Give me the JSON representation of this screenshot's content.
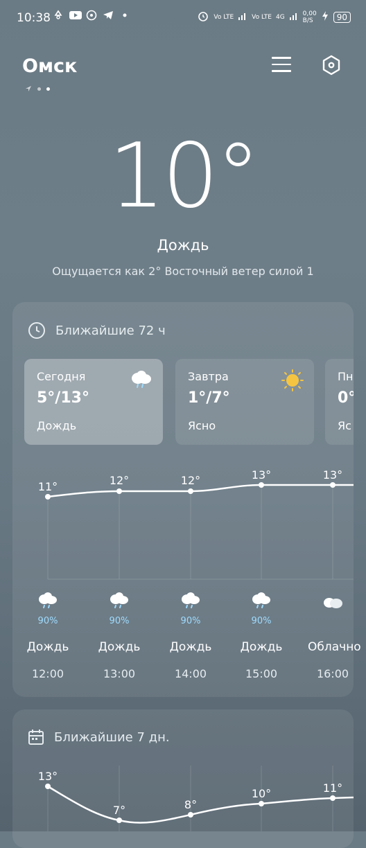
{
  "status_bar": {
    "time": "10:38",
    "net1": "Vo LTE",
    "net2": "Vo LTE",
    "net3": "4G",
    "speed": "0,00",
    "speed_unit": "B/S",
    "battery": "90"
  },
  "header": {
    "city": "Омск",
    "menu_icon": "menu-icon",
    "settings_icon": "settings-icon"
  },
  "current": {
    "temp": "10°",
    "condition": "Дождь",
    "feels": "Ощущается как  2°  Восточный ветер силой 1"
  },
  "hourly_card": {
    "title": "Ближайшие 72 ч",
    "tiles": [
      {
        "label": "Сегодня",
        "range": "5°/13°",
        "cond": "Дождь",
        "icon": "rain-cloud-icon"
      },
      {
        "label": "Завтра",
        "range": "1°/7°",
        "cond": "Ясно",
        "icon": "sun-icon"
      },
      {
        "label": "Пн",
        "range": "0°",
        "cond": "Яс",
        "icon": ""
      }
    ],
    "hours": [
      {
        "temp": "11°",
        "pct": "90%",
        "cond": "Дождь",
        "time": "12:00"
      },
      {
        "temp": "12°",
        "pct": "90%",
        "cond": "Дождь",
        "time": "13:00"
      },
      {
        "temp": "12°",
        "pct": "90%",
        "cond": "Дождь",
        "time": "14:00"
      },
      {
        "temp": "13°",
        "pct": "90%",
        "cond": "Дождь",
        "time": "15:00"
      },
      {
        "temp": "13°",
        "pct": "",
        "cond": "Облачно",
        "time": "16:00"
      }
    ]
  },
  "daily_card": {
    "title": "Ближайшие 7 дн.",
    "days": [
      {
        "temp": "13°"
      },
      {
        "temp": "7°"
      },
      {
        "temp": "8°"
      },
      {
        "temp": "10°"
      },
      {
        "temp": "11°"
      }
    ]
  },
  "colors": {
    "rain_pct": "#9fdcff",
    "sun": "#f5c542"
  }
}
